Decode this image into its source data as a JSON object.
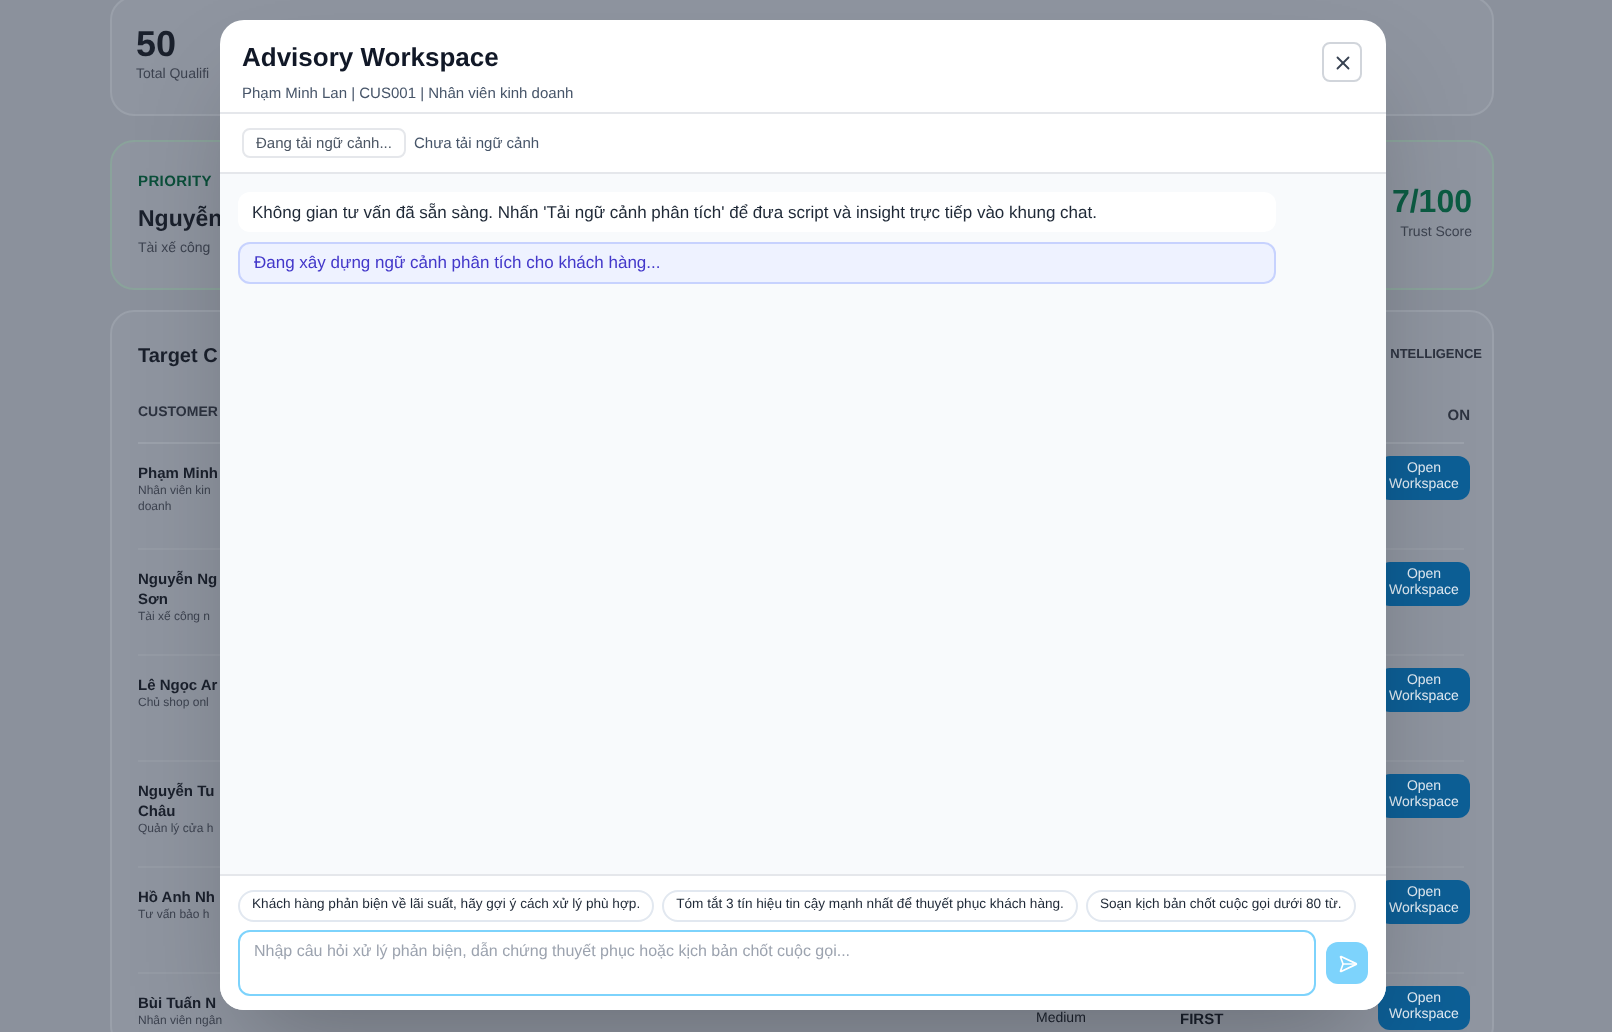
{
  "background": {
    "stat": {
      "value": "50",
      "label": "Total Qualifi"
    },
    "priority": {
      "label": "PRIORITY",
      "name": "Nguyễn",
      "subtitle": "Tài xế công",
      "score": "7/100",
      "score_label": "Trust Score"
    },
    "table": {
      "title": "Target C",
      "right_title": "NTELLIGENCE",
      "columns": [
        "CUSTOMER",
        "ON"
      ],
      "rows": [
        {
          "name": [
            "Phạm Minh"
          ],
          "subtitle": [
            "Nhân viên kin",
            "doanh"
          ],
          "action": "Open Workspace"
        },
        {
          "name": [
            "Nguyễn Ng",
            "Sơn"
          ],
          "subtitle": [
            "Tài xế công n"
          ],
          "action": "Open Workspace"
        },
        {
          "name": [
            "Lê Ngọc Ar"
          ],
          "subtitle": [
            "Chủ shop onl"
          ],
          "action": "Open Workspace"
        },
        {
          "name": [
            "Nguyễn Tu",
            "Châu"
          ],
          "subtitle": [
            "Quản lý cửa h"
          ],
          "action": "Open Workspace"
        },
        {
          "name": [
            "Hồ Anh Nh"
          ],
          "subtitle": [
            "Tư vấn bảo h"
          ],
          "action": "Open Workspace"
        },
        {
          "name": [
            "Bùi Tuấn N"
          ],
          "subtitle": [
            "Nhân viên ngân"
          ],
          "level": "Medium",
          "priority": "FIRST",
          "action": "Open Workspace"
        }
      ]
    }
  },
  "modal": {
    "title": "Advisory Workspace",
    "subtitle": "Phạm Minh Lan | CUS001 | Nhân viên kinh doanh",
    "load_button": {
      "label": "Đang tải ngữ cảnh...",
      "disabled": true
    },
    "context_status": "Chưa tải ngữ cảnh",
    "messages": [
      {
        "kind": "system",
        "text": "Không gian tư vấn đã sẵn sàng. Nhấn 'Tải ngữ cảnh phân tích' để đưa script và insight trực tiếp vào khung chat."
      },
      {
        "kind": "loading",
        "text": "Đang xây dựng ngữ cảnh phân tích cho khách hàng..."
      }
    ],
    "suggestions": [
      "Khách hàng phản biện về lãi suất, hãy gợi ý cách xử lý phù hợp.",
      "Tóm tắt 3 tín hiệu tin cậy mạnh nhất để thuyết phục khách hàng.",
      "Soạn kịch bản chốt cuộc gọi dưới 80 từ."
    ],
    "input": {
      "placeholder": "Nhập câu hỏi xử lý phản biện, dẫn chứng thuyết phục hoặc kịch bản chốt cuộc gọi..."
    },
    "send_disabled": true
  }
}
